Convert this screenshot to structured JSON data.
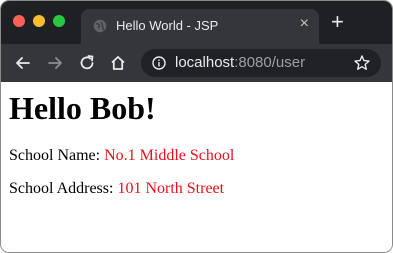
{
  "tab": {
    "title": "Hello World - JSP",
    "favicon": "globe-icon",
    "close": "×"
  },
  "newtab": {
    "label": "+"
  },
  "address": {
    "host": "localhost",
    "rest": ":8080/user"
  },
  "page": {
    "heading": "Hello Bob!",
    "school_name_label": "School Name: ",
    "school_name_value": "No.1 Middle School",
    "school_address_label": "School Address: ",
    "school_address_value": "101 North Street"
  },
  "colors": {
    "value_text": "#e8101a",
    "toolbar": "#35363a",
    "titlebar": "#1f2023"
  }
}
